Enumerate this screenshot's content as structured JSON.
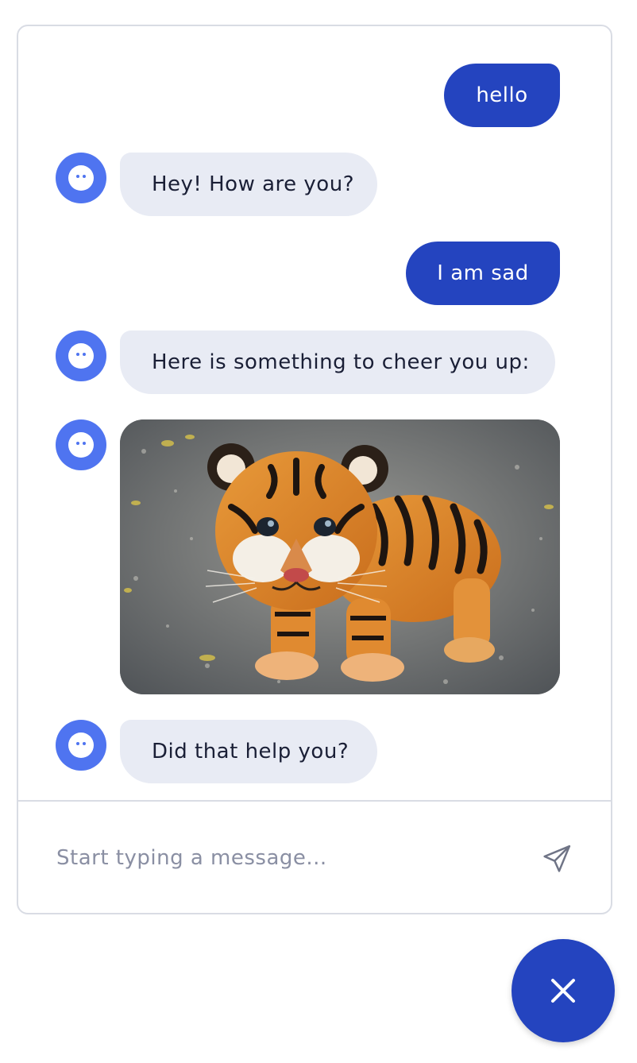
{
  "messages": [
    {
      "sender": "user",
      "text": "hello"
    },
    {
      "sender": "bot",
      "text": "Hey! How are you?"
    },
    {
      "sender": "user",
      "text": "I am sad"
    },
    {
      "sender": "bot",
      "text": "Here is something to cheer you up:"
    },
    {
      "sender": "bot",
      "type": "image"
    },
    {
      "sender": "bot",
      "text": "Did that help you?"
    }
  ],
  "composer": {
    "placeholder": "Start typing a message..."
  },
  "colors": {
    "user_bubble": "#2444bf",
    "bot_bubble": "#e8ebf4",
    "avatar": "#4f74f0",
    "fab": "#2444bf"
  },
  "icons": {
    "avatar": "bot-face-icon",
    "send": "paper-plane-icon",
    "close": "close-icon"
  }
}
